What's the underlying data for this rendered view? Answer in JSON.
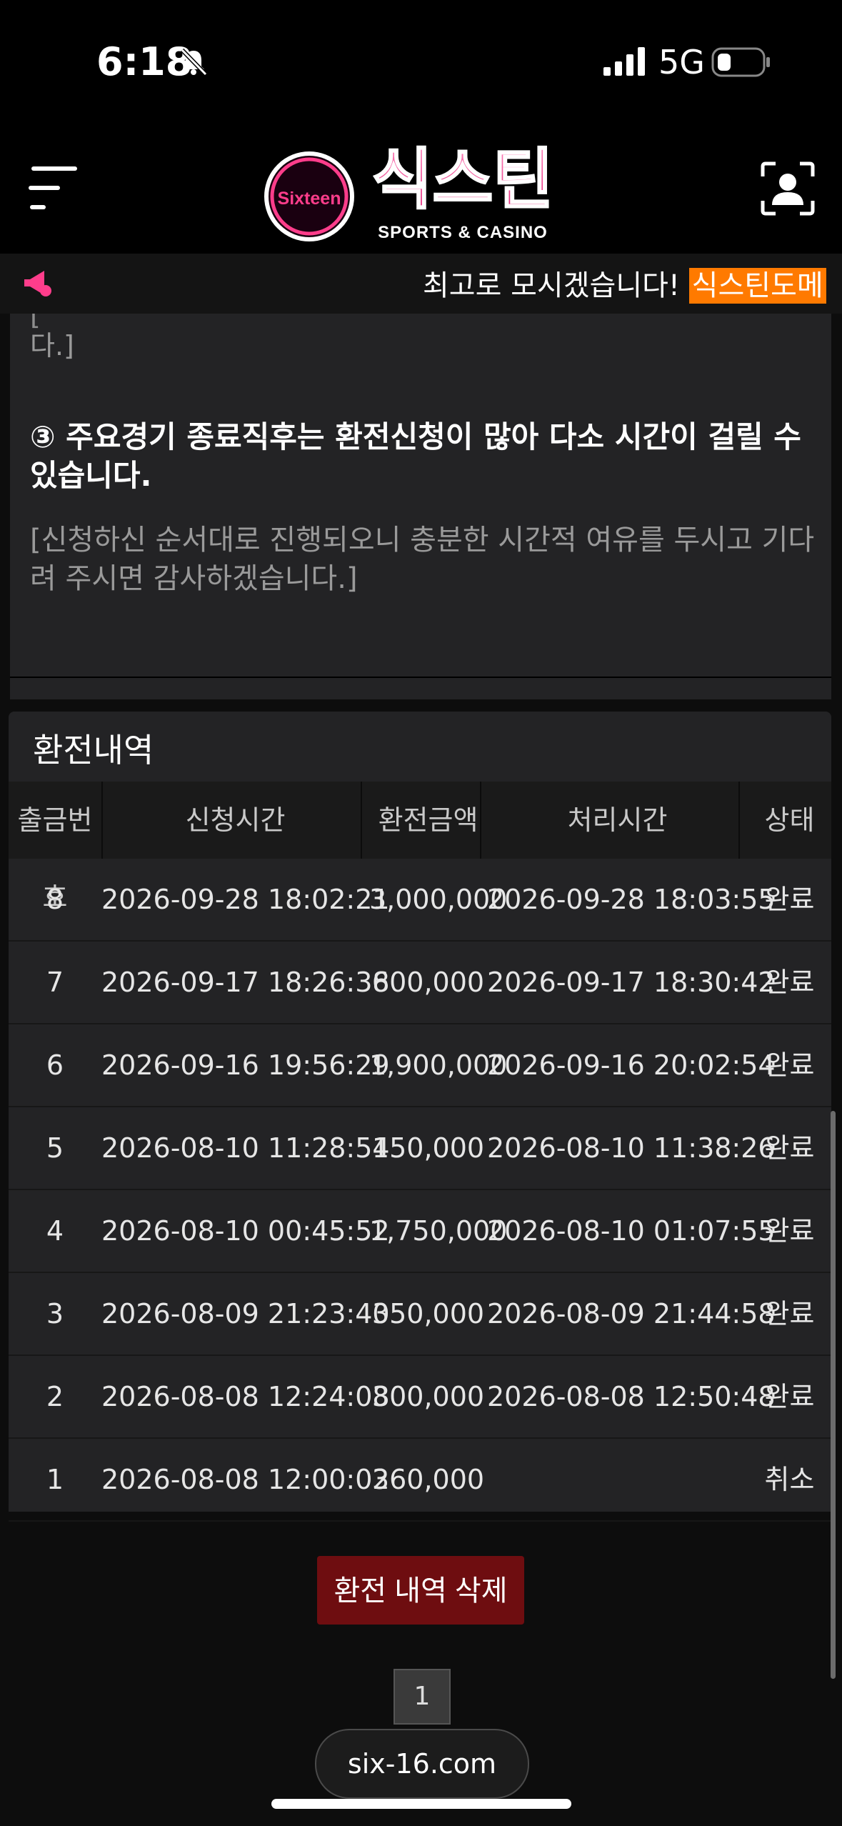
{
  "status_bar": {
    "time": "6:18",
    "network": "5G",
    "icons": [
      "bell-muted-icon",
      "signal-icon",
      "battery-icon"
    ]
  },
  "header": {
    "logo_badge": "Sixteen",
    "logo_title": "식스틴",
    "logo_subtitle": "SPORTS & CASINO",
    "icons": [
      "menu-icon",
      "profile-icon"
    ],
    "accent_color": "#ff3d8b"
  },
  "marquee": {
    "text": "최고로 모시겠습니다!",
    "highlight": "식스틴도메",
    "highlight_color": "#ff7a00"
  },
  "notice": {
    "cut_text": "[",
    "cut_text_2": "다.]",
    "heading": "③ 주요경기 종료직후는 환전신청이 많아 다소 시간이 걸릴 수 있습니다.",
    "sub": "[신청하신 순서대로 진행되오니 충분한 시간적 여유를 두시고 기다려 주시면 감사하겠습니다.]"
  },
  "history": {
    "title": "환전내역",
    "columns": [
      "출금번호",
      "신청시간",
      "환전금액",
      "처리시간",
      "상태"
    ],
    "rows": [
      {
        "no": "8",
        "requested": "2026-09-28 18:02:21",
        "amount": "3,000,000",
        "processed": "2026-09-28 18:03:55",
        "status": "완료"
      },
      {
        "no": "7",
        "requested": "2026-09-17 18:26:38",
        "amount": "600,000",
        "processed": "2026-09-17 18:30:42",
        "status": "완료"
      },
      {
        "no": "6",
        "requested": "2026-09-16 19:56:29",
        "amount": "1,900,000",
        "processed": "2026-09-16 20:02:54",
        "status": "완료"
      },
      {
        "no": "5",
        "requested": "2026-08-10 11:28:54",
        "amount": "150,000",
        "processed": "2026-08-10 11:38:26",
        "status": "완료"
      },
      {
        "no": "4",
        "requested": "2026-08-10 00:45:52",
        "amount": "1,750,000",
        "processed": "2026-08-10 01:07:55",
        "status": "완료"
      },
      {
        "no": "3",
        "requested": "2026-08-09 21:23:40",
        "amount": "350,000",
        "processed": "2026-08-09 21:44:58",
        "status": "완료"
      },
      {
        "no": "2",
        "requested": "2026-08-08 12:24:08",
        "amount": "300,000",
        "processed": "2026-08-08 12:50:48",
        "status": "완료"
      },
      {
        "no": "1",
        "requested": "2026-08-08 12:00:02",
        "amount": "360,000",
        "processed": "",
        "status": "취소"
      }
    ]
  },
  "actions": {
    "delete_label": "환전 내역 삭제",
    "delete_color": "#6e0d10",
    "page": "1"
  },
  "footer": {
    "domain": "six-16.com"
  }
}
